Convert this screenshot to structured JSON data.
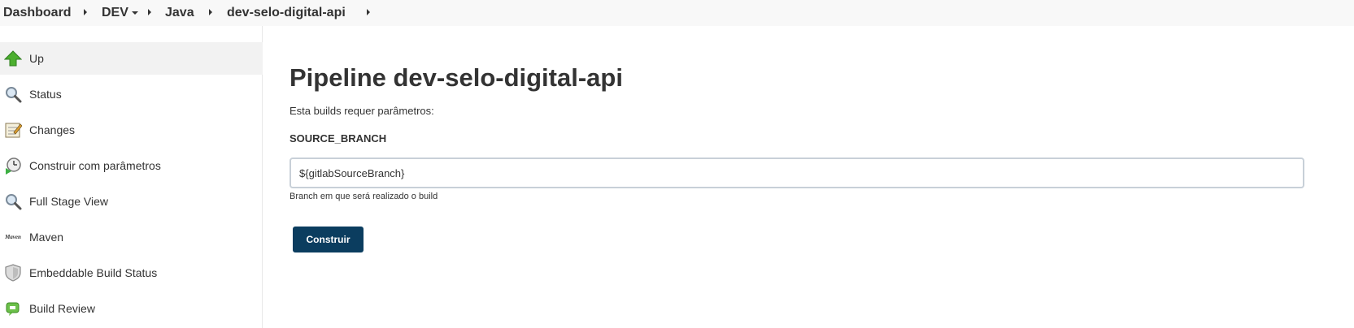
{
  "breadcrumb": {
    "items": [
      {
        "label": "Dashboard"
      },
      {
        "label": "DEV"
      },
      {
        "label": "Java"
      },
      {
        "label": "dev-selo-digital-api"
      }
    ]
  },
  "sidebar": {
    "items": [
      {
        "label": "Up",
        "icon": "up-arrow-icon"
      },
      {
        "label": "Status",
        "icon": "search-icon"
      },
      {
        "label": "Changes",
        "icon": "notepad-icon"
      },
      {
        "label": "Construir com parâmetros",
        "icon": "build-clock-icon"
      },
      {
        "label": "Full Stage View",
        "icon": "search-icon"
      },
      {
        "label": "Maven",
        "icon": "maven-logo-icon",
        "logo_text": "Maven"
      },
      {
        "label": "Embeddable Build Status",
        "icon": "shield-icon"
      },
      {
        "label": "Build Review",
        "icon": "review-icon"
      }
    ]
  },
  "main": {
    "title": "Pipeline dev-selo-digital-api",
    "requires_text": "Esta builds requer parâmetros:",
    "param": {
      "name": "SOURCE_BRANCH",
      "value": "${gitlabSourceBranch}",
      "help": "Branch em que será realizado o build"
    },
    "build_button": "Construir"
  },
  "colors": {
    "accent": "#0b3d5f",
    "breadcrumb_bg": "#f8f8f8",
    "sidebar_active_bg": "#f2f2f2"
  }
}
